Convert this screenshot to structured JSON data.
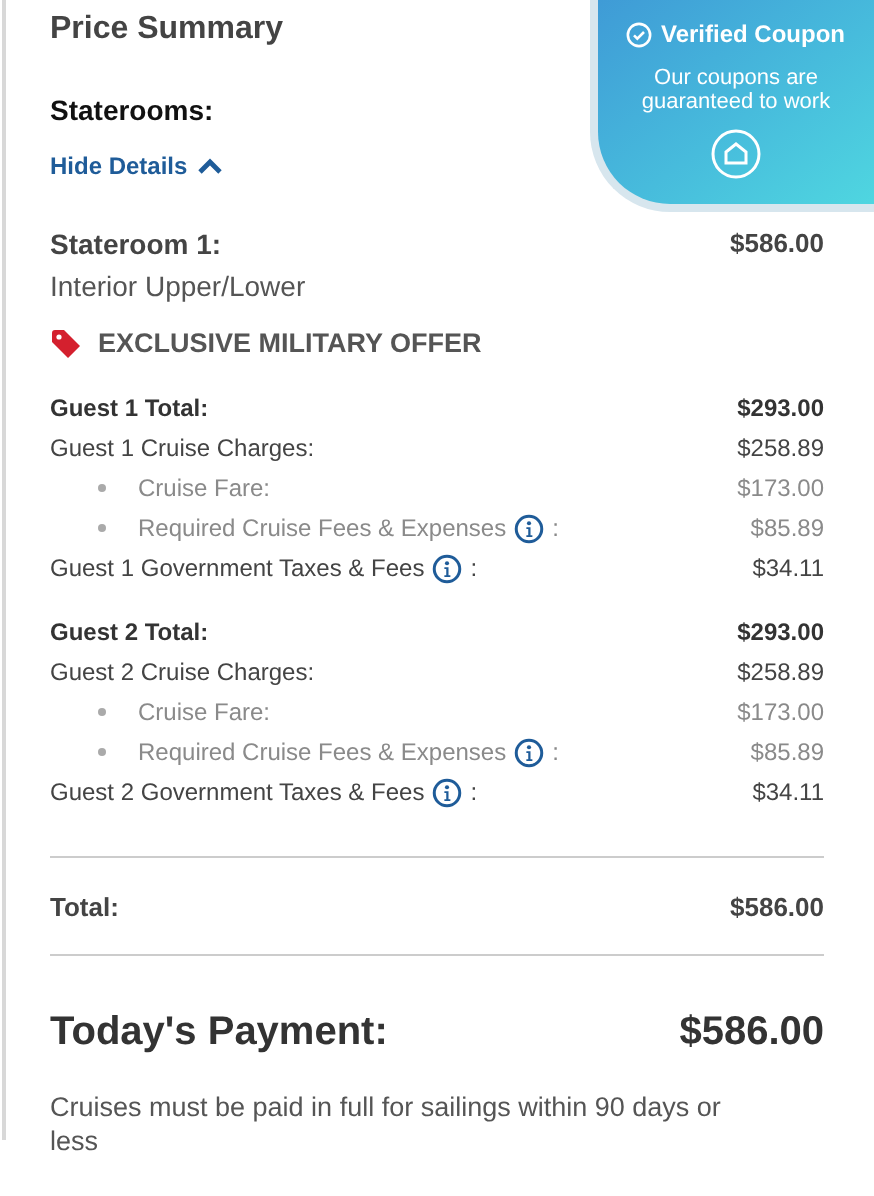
{
  "title": "Price Summary",
  "staterooms_label": "Staterooms:",
  "details_toggle": {
    "label": "Hide Details",
    "expanded": true
  },
  "stateroom": {
    "name": "Stateroom 1:",
    "type": "Interior Upper/Lower",
    "price": "$586.00",
    "offer": "EXCLUSIVE MILITARY OFFER"
  },
  "guests": [
    {
      "lines": [
        {
          "kind": "total",
          "label": "Guest 1 Total:",
          "amount": "$293.00",
          "info": false
        },
        {
          "kind": "line",
          "label": "Guest 1 Cruise Charges:",
          "amount": "$258.89",
          "info": false
        },
        {
          "kind": "sub",
          "label": "Cruise Fare:",
          "amount": "$173.00",
          "info": false
        },
        {
          "kind": "sub",
          "label": "Required Cruise Fees & Expenses",
          "amount": "$85.89",
          "info": true,
          "suffix": ":"
        },
        {
          "kind": "line",
          "label": "Guest 1 Government Taxes & Fees",
          "amount": "$34.11",
          "info": true,
          "suffix": ":"
        }
      ]
    },
    {
      "lines": [
        {
          "kind": "total",
          "label": "Guest 2 Total:",
          "amount": "$293.00",
          "info": false
        },
        {
          "kind": "line",
          "label": "Guest 2 Cruise Charges:",
          "amount": "$258.89",
          "info": false
        },
        {
          "kind": "sub",
          "label": "Cruise Fare:",
          "amount": "$173.00",
          "info": false
        },
        {
          "kind": "sub",
          "label": "Required Cruise Fees & Expenses",
          "amount": "$85.89",
          "info": true,
          "suffix": ":"
        },
        {
          "kind": "line",
          "label": "Guest 2 Government Taxes & Fees",
          "amount": "$34.11",
          "info": true,
          "suffix": ":"
        }
      ]
    }
  ],
  "total": {
    "label": "Total:",
    "amount": "$586.00"
  },
  "payment": {
    "label": "Today's Payment:",
    "amount": "$586.00"
  },
  "note": "Cruises must be paid in full for sailings within 90 days or less",
  "coupon": {
    "title": "Verified Coupon",
    "text": "Our coupons are guaranteed to work"
  }
}
